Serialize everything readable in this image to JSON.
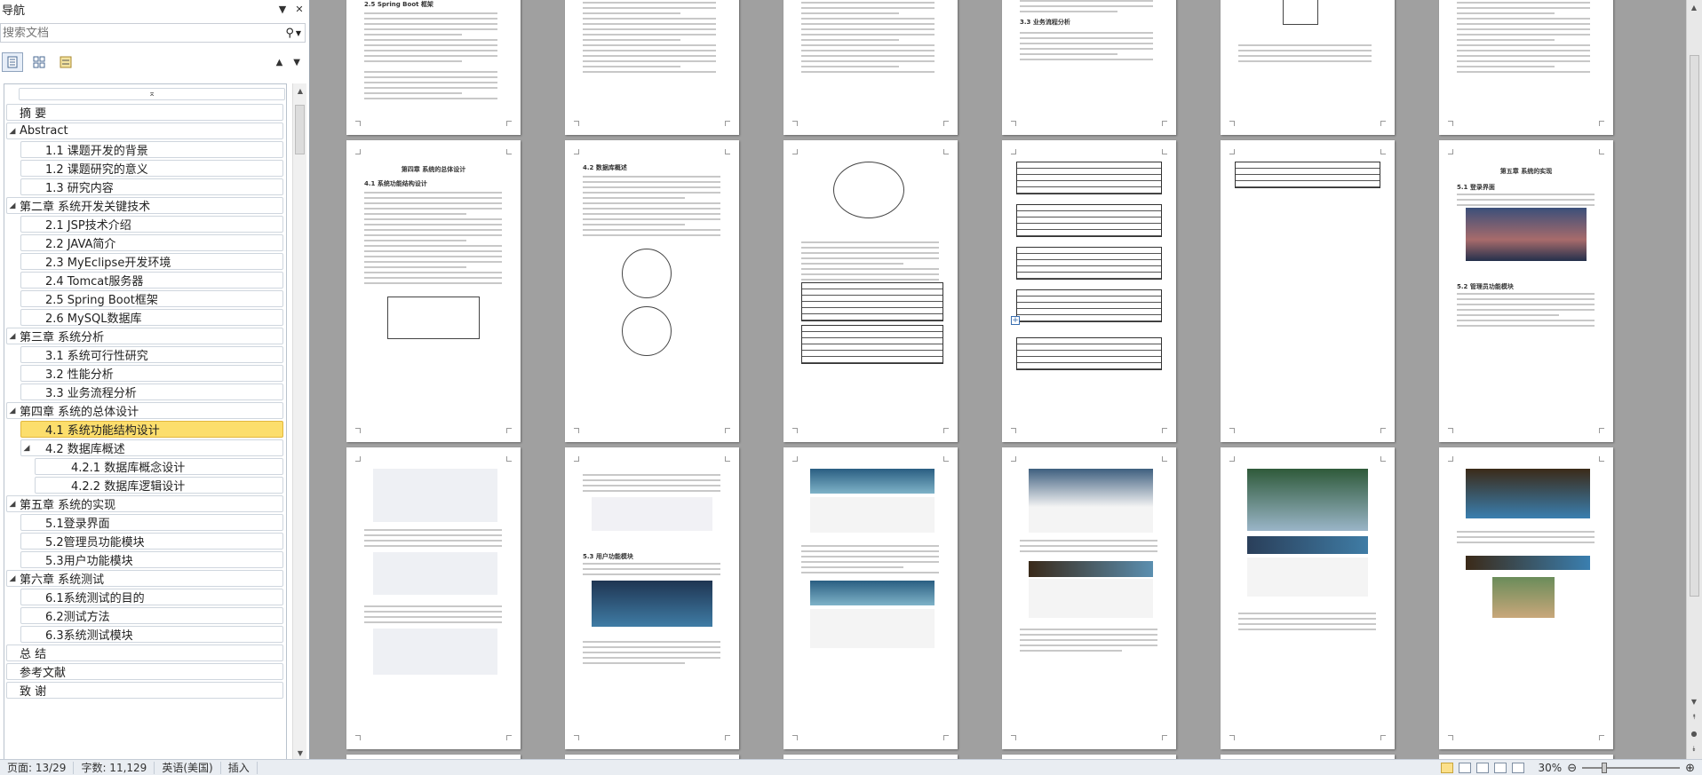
{
  "nav": {
    "title": "导航",
    "search": {
      "placeholder": "搜索文档"
    },
    "outline": [
      {
        "label": "摘 要",
        "level": 1,
        "toggle": ""
      },
      {
        "label": "Abstract",
        "level": 1,
        "toggle": "◢"
      },
      {
        "label": "1.1 课题开发的背景",
        "level": 2,
        "toggle": ""
      },
      {
        "label": "1.2 课题研究的意义",
        "level": 2,
        "toggle": ""
      },
      {
        "label": "1.3 研究内容",
        "level": 2,
        "toggle": ""
      },
      {
        "label": "第二章 系统开发关键技术",
        "level": 1,
        "toggle": "◢"
      },
      {
        "label": "2.1 JSP技术介绍",
        "level": 2,
        "toggle": ""
      },
      {
        "label": "2.2 JAVA简介",
        "level": 2,
        "toggle": ""
      },
      {
        "label": "2.3 MyEclipse开发环境",
        "level": 2,
        "toggle": ""
      },
      {
        "label": "2.4 Tomcat服务器",
        "level": 2,
        "toggle": ""
      },
      {
        "label": "2.5 Spring Boot框架",
        "level": 2,
        "toggle": ""
      },
      {
        "label": "2.6 MySQL数据库",
        "level": 2,
        "toggle": ""
      },
      {
        "label": "第三章 系统分析",
        "level": 1,
        "toggle": "◢"
      },
      {
        "label": "3.1 系统可行性研究",
        "level": 2,
        "toggle": ""
      },
      {
        "label": "3.2 性能分析",
        "level": 2,
        "toggle": ""
      },
      {
        "label": "3.3 业务流程分析",
        "level": 2,
        "toggle": ""
      },
      {
        "label": "第四章 系统的总体设计",
        "level": 1,
        "toggle": "◢"
      },
      {
        "label": "4.1 系统功能结构设计",
        "level": 2,
        "toggle": "",
        "selected": true
      },
      {
        "label": "4.2 数据库概述",
        "level": 2,
        "toggle": "◢"
      },
      {
        "label": "4.2.1 数据库概念设计",
        "level": 3,
        "toggle": ""
      },
      {
        "label": "4.2.2 数据库逻辑设计",
        "level": 3,
        "toggle": ""
      },
      {
        "label": "第五章 系统的实现",
        "level": 1,
        "toggle": "◢"
      },
      {
        "label": "5.1登录界面",
        "level": 2,
        "toggle": ""
      },
      {
        "label": "5.2管理员功能模块",
        "level": 2,
        "toggle": ""
      },
      {
        "label": "5.3用户功能模块",
        "level": 2,
        "toggle": ""
      },
      {
        "label": "第六章 系统测试",
        "level": 1,
        "toggle": "◢"
      },
      {
        "label": "6.1系统测试的目的",
        "level": 2,
        "toggle": ""
      },
      {
        "label": "6.2测试方法",
        "level": 2,
        "toggle": ""
      },
      {
        "label": "6.3系统测试模块",
        "level": 2,
        "toggle": ""
      },
      {
        "label": "总 结",
        "level": 1,
        "toggle": ""
      },
      {
        "label": "参考文献",
        "level": 1,
        "toggle": ""
      },
      {
        "label": "致 谢",
        "level": 1,
        "toggle": ""
      }
    ]
  },
  "pages": {
    "p_chapter4_title": "第四章  系统的总体设计",
    "p_chapter5_title": "第五章  系统的实现",
    "p_sec_41": "4.1 系统功能结构设计",
    "p_sec_42": "4.2 数据库概述",
    "p_sec_51": "5.1 登录界面",
    "p_sec_52": "5.2 管理员功能模块",
    "p_sec_53": "5.3 用户功能模块",
    "p_sec_33": "3.3 业务流程分析",
    "p_sec_25": "2.5   Spring   Boot 框架"
  },
  "status": {
    "page": "页面: 13/29",
    "words": "字数: 11,129",
    "language": "英语(美国)",
    "mode": "插入",
    "zoom": "30%"
  }
}
